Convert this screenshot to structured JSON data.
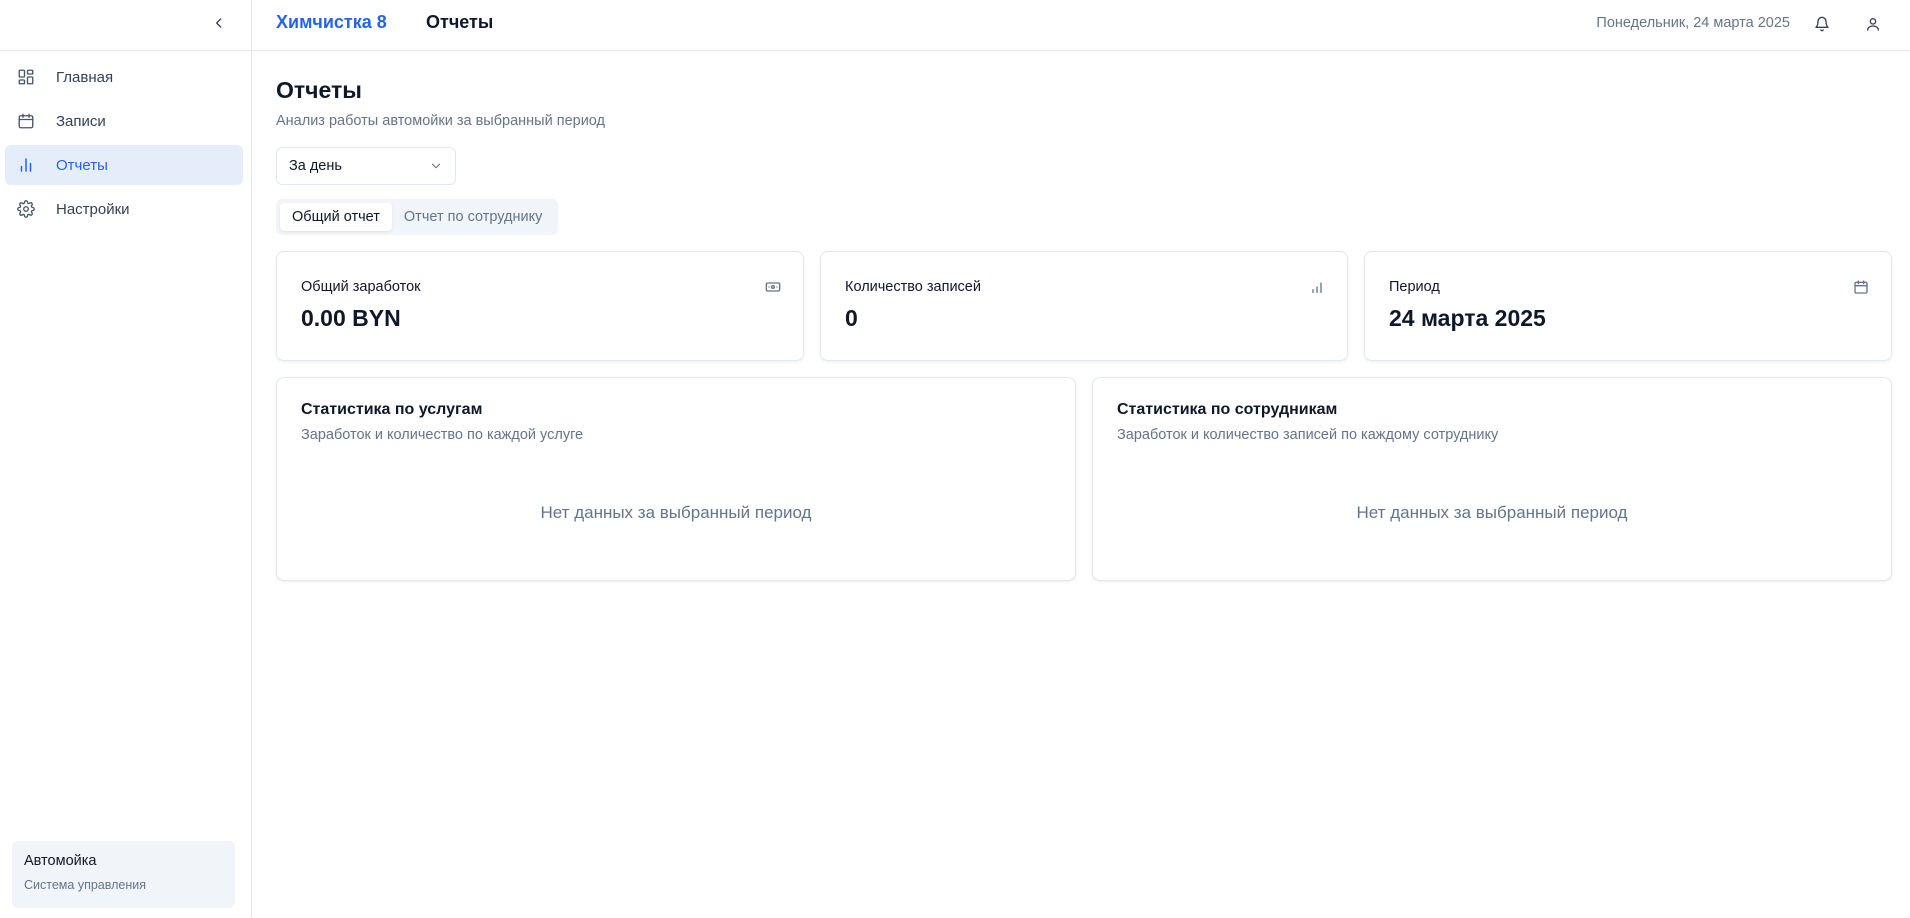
{
  "sidebar": {
    "collapse_icon": "chevron-left-icon",
    "items": [
      {
        "label": "Главная",
        "icon": "dashboard-icon",
        "active": false
      },
      {
        "label": "Записи",
        "icon": "calendar-icon",
        "active": false
      },
      {
        "label": "Отчеты",
        "icon": "bar-chart-icon",
        "active": true
      },
      {
        "label": "Настройки",
        "icon": "gear-icon",
        "active": false
      }
    ],
    "org": {
      "name": "Автомойка",
      "subtitle": "Система управления"
    }
  },
  "header": {
    "brand": "Химчистка 8",
    "page": "Отчеты",
    "date": "Понедельник, 24 марта 2025",
    "icons": [
      "bell-icon",
      "user-icon"
    ]
  },
  "main": {
    "title": "Отчеты",
    "subtitle": "Анализ работы автомойки за выбранный период",
    "period_select": {
      "value": "За день"
    },
    "tabs": [
      {
        "label": "Общий отчет",
        "active": true
      },
      {
        "label": "Отчет по сотруднику",
        "active": false
      }
    ],
    "stats": [
      {
        "label": "Общий заработок",
        "value": "0.00 BYN",
        "icon": "banknote-icon"
      },
      {
        "label": "Количество записей",
        "value": "0",
        "icon": "bar-chart-icon"
      },
      {
        "label": "Период",
        "value": "24 марта 2025",
        "icon": "calendar-icon"
      }
    ],
    "panels": [
      {
        "title": "Статистика по услугам",
        "subtitle": "Заработок и количество по каждой услуге",
        "empty": "Нет данных за выбранный период"
      },
      {
        "title": "Статистика по сотрудникам",
        "subtitle": "Заработок и количество записей по каждому сотруднику",
        "empty": "Нет данных за выбранный период"
      }
    ]
  },
  "colors": {
    "accent": "#2563eb",
    "active_bg": "#e5edfb",
    "muted_text": "#64748b",
    "border": "#e2e8f0"
  }
}
